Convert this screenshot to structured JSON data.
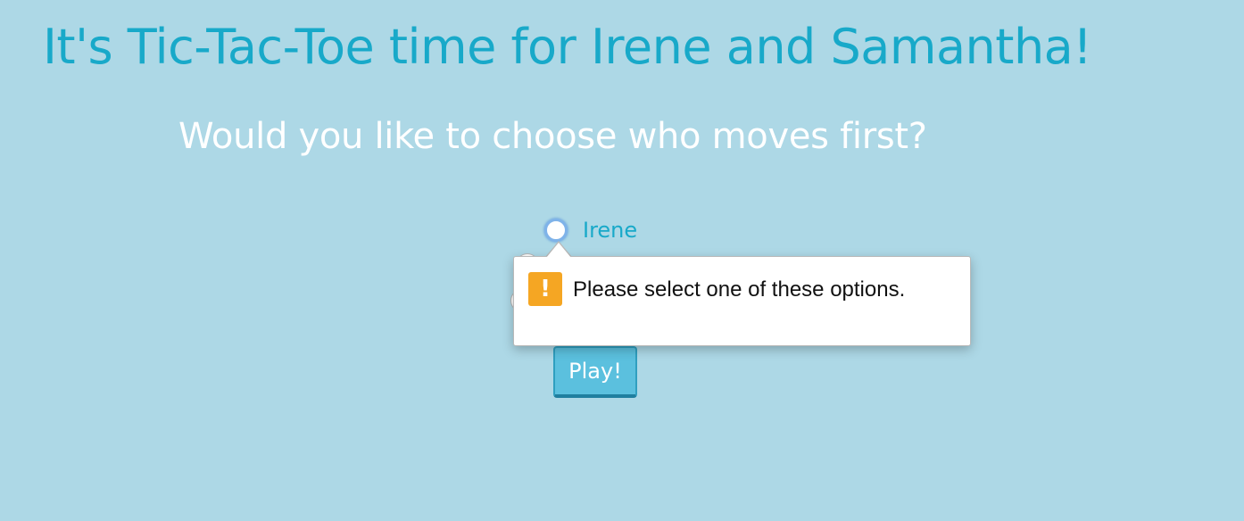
{
  "header": {
    "title": "It's Tic-Tac-Toe time for Irene and Samantha!",
    "question": "Would you like to choose who moves first?"
  },
  "players": {
    "options": [
      {
        "label": "Irene",
        "selected": false
      }
    ]
  },
  "validation": {
    "message": "Please select one of these options.",
    "icon": "warning-icon"
  },
  "actions": {
    "play_label": "Play!"
  },
  "colors": {
    "background": "#add8e6",
    "title": "#18a9c9",
    "button": "#5bc0de",
    "warning": "#f5a623"
  }
}
